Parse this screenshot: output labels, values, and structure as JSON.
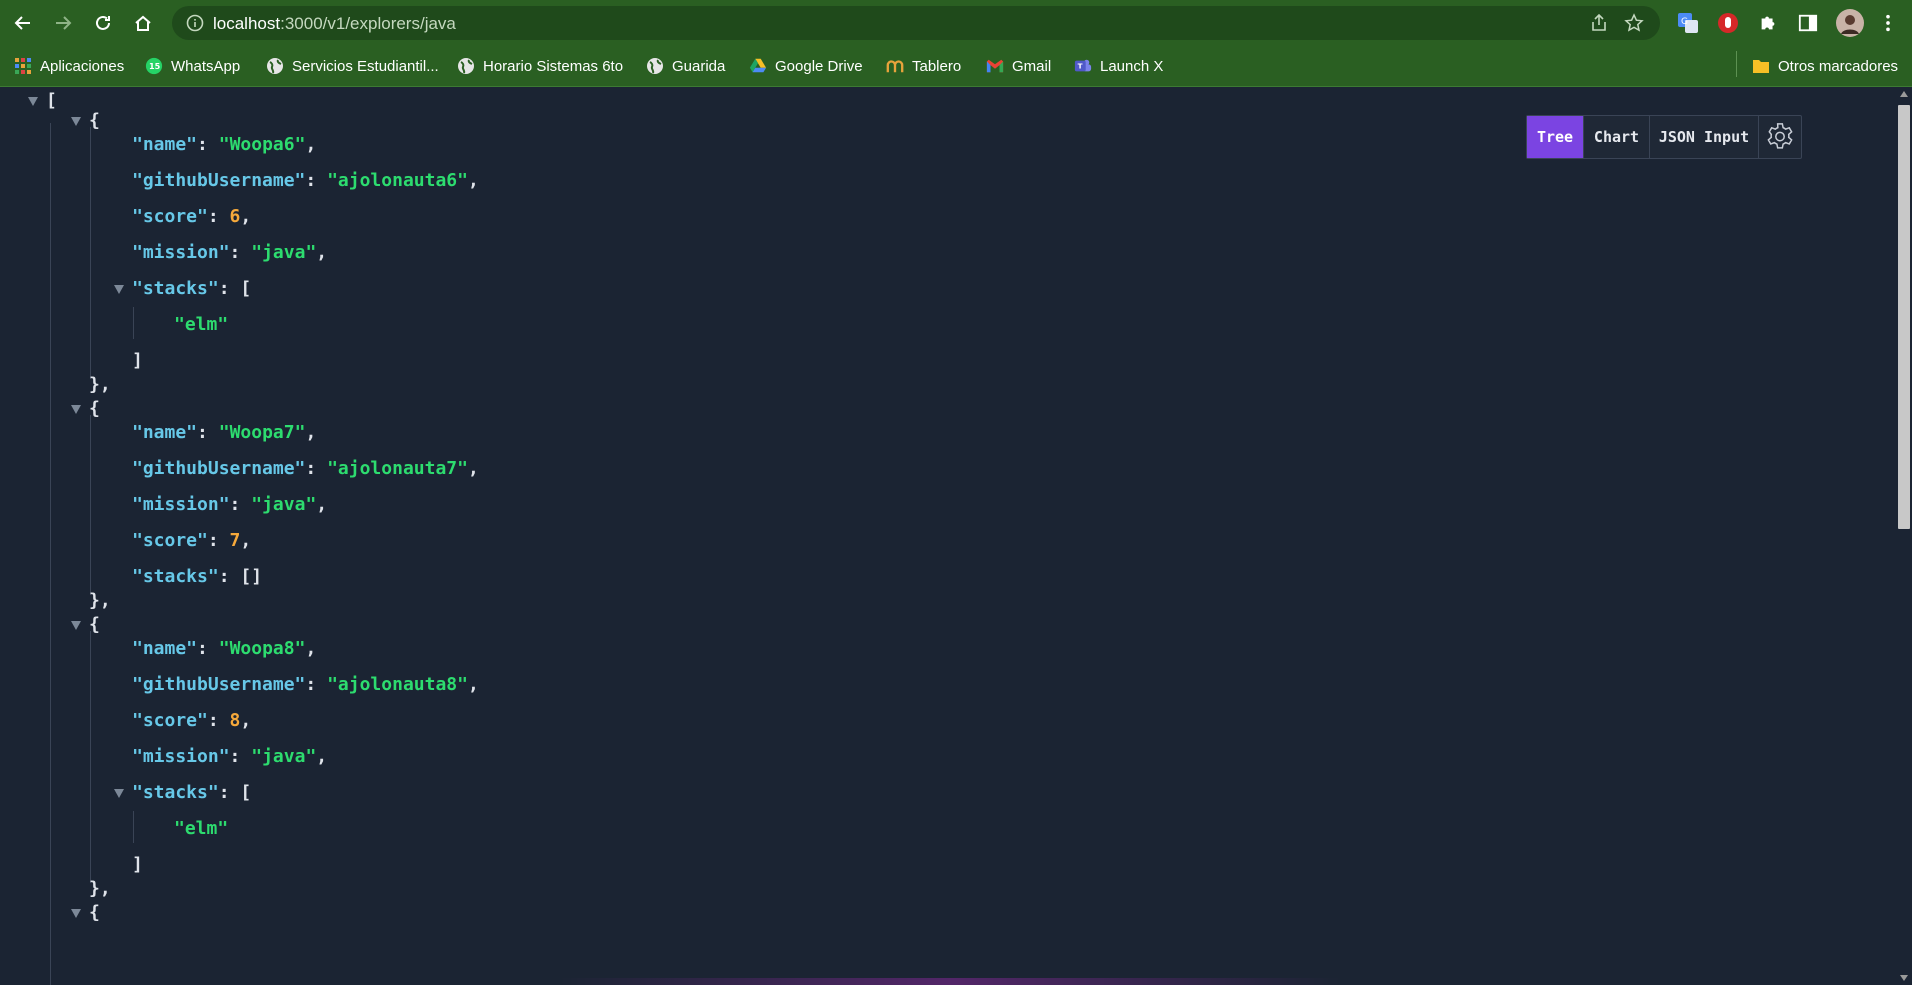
{
  "browser": {
    "url_host": "localhost",
    "url_path": ":3000/v1/explorers/java",
    "icons": [
      "back-icon",
      "forward-icon",
      "reload-icon",
      "home-icon",
      "info-icon",
      "share-icon",
      "star-icon",
      "translate-icon",
      "extension-red-icon",
      "puzzle-icon",
      "sidepanel-icon",
      "avatar",
      "menu-icon"
    ]
  },
  "bookmarks": {
    "items": [
      {
        "label": "Aplicaciones",
        "icon": "apps-grid-icon"
      },
      {
        "label": "WhatsApp",
        "icon": "whatsapp-icon",
        "badge": "15"
      },
      {
        "label": "Servicios Estudiantil...",
        "icon": "globe-icon"
      },
      {
        "label": "Horario Sistemas 6to",
        "icon": "globe-icon"
      },
      {
        "label": "Guarida",
        "icon": "globe-icon"
      },
      {
        "label": "Google Drive",
        "icon": "drive-icon"
      },
      {
        "label": "Tablero",
        "icon": "tablero-icon"
      },
      {
        "label": "Gmail",
        "icon": "gmail-icon"
      },
      {
        "label": "Launch X",
        "icon": "teams-icon"
      }
    ],
    "other": "Otros marcadores"
  },
  "viewer": {
    "tabs": [
      {
        "label": "Tree",
        "active": true
      },
      {
        "label": "Chart",
        "active": false
      },
      {
        "label": "JSON Input",
        "active": false
      }
    ],
    "settings_icon": "gear-icon",
    "records": [
      {
        "name": "Woopa6",
        "githubUsername": "ajolonauta6",
        "score": "6",
        "mission": "java",
        "stacks": [
          "elm"
        ],
        "order": [
          "name",
          "githubUsername",
          "score",
          "mission",
          "stacks"
        ]
      },
      {
        "name": "Woopa7",
        "githubUsername": "ajolonauta7",
        "mission": "java",
        "score": "7",
        "stacks": [],
        "order": [
          "name",
          "githubUsername",
          "mission",
          "score",
          "stacks"
        ]
      },
      {
        "name": "Woopa8",
        "githubUsername": "ajolonauta8",
        "score": "8",
        "mission": "java",
        "stacks": [
          "elm"
        ],
        "order": [
          "name",
          "githubUsername",
          "score",
          "mission",
          "stacks"
        ]
      }
    ],
    "colors": {
      "key": "#67c8e8",
      "string": "#2ddc6f",
      "number": "#f6a93b",
      "punct": "#dfe3ea",
      "accent": "#7b44e2"
    }
  }
}
